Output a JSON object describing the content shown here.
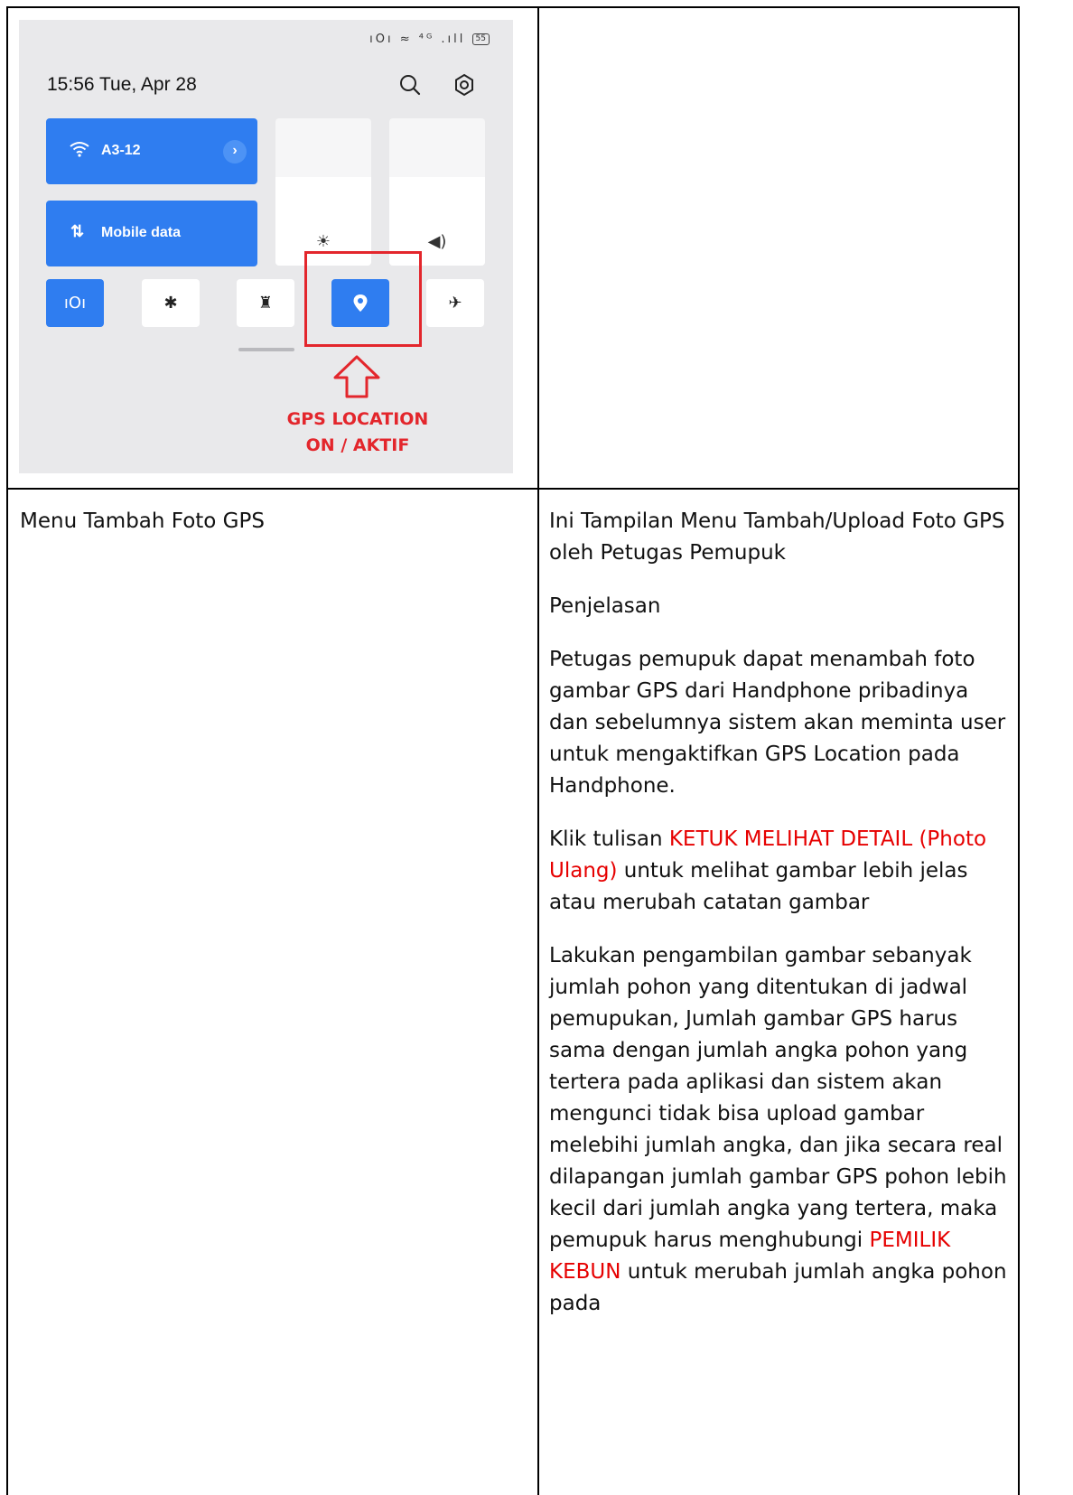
{
  "phone": {
    "status_icons": "ıOı ≈ ⁴ᴳ .ıll",
    "battery": "55",
    "clock": "15:56  Tue, Apr 28",
    "wifi_tile_label": "A3-12",
    "mobile_data_label": "Mobile data",
    "data_glyph": "⇅",
    "chevron": "›",
    "brightness_level": 0.6,
    "volume_level": 0.6,
    "tiles": {
      "vibrate": "ıOı",
      "bluetooth": "✱",
      "torch": "♜",
      "location": "●",
      "airplane": "✈"
    },
    "gps_caption_line1": "GPS LOCATION",
    "gps_caption_line2": "ON / AKTIF",
    "accent_color": "#2f7df0",
    "highlight_color": "#e3262c"
  },
  "left_cell": {
    "caption": "Menu Tambah Foto GPS"
  },
  "right_cell": {
    "intro": "Ini Tampilan Menu Tambah/Upload Foto GPS oleh Petugas Pemupuk",
    "heading": "Penjelasan",
    "para1": "Petugas pemupuk dapat menambah foto gambar GPS dari Handphone pribadinya dan sebelumnya sistem akan meminta user untuk mengaktifkan GPS Location pada Handphone.",
    "para2_prefix": "Klik tulisan ",
    "para2_highlight": "KETUK MELIHAT DETAIL (Photo Ulang)",
    "para2_suffix": " untuk melihat gambar lebih jelas atau merubah catatan gambar",
    "para3_prefix": "Lakukan pengambilan gambar sebanyak jumlah pohon yang ditentukan di jadwal pemupukan, Jumlah gambar GPS harus sama dengan jumlah angka pohon yang tertera pada aplikasi dan sistem akan mengunci tidak bisa upload gambar melebihi jumlah angka, dan jika secara real dilapangan jumlah gambar GPS pohon lebih kecil dari jumlah angka yang tertera, maka pemupuk harus menghubungi ",
    "para3_highlight": "PEMILIK KEBUN",
    "para3_suffix": " untuk merubah jumlah angka pohon pada",
    "highlight_color": "#e60000"
  }
}
